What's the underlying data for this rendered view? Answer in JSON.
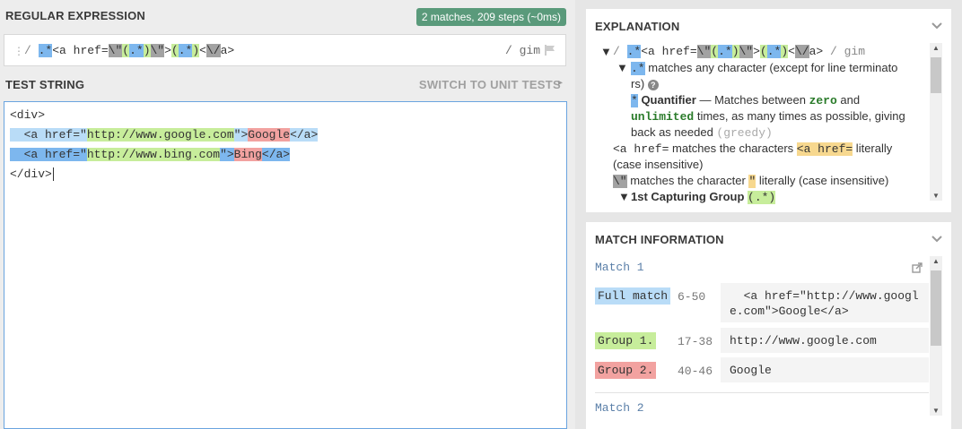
{
  "regex_section": {
    "title": "REGULAR EXPRESSION",
    "badge": "2 matches, 209 steps (~0ms)",
    "delimiter_open": "/",
    "pattern_parts": [
      ".*",
      "<a href=",
      "\\\"",
      "(",
      ".*",
      ")",
      "\\\"",
      ">",
      "(",
      ".*",
      ")",
      "<",
      "\\/",
      "a>"
    ],
    "flags": "/ gim"
  },
  "test_section": {
    "title": "TEST STRING",
    "switch_label": "SWITCH TO UNIT TESTS",
    "lines": {
      "l1": "<div>",
      "l2_pre": "  <a href=\"",
      "l2_g1": "http://www.google.com",
      "l2_mid": "\">",
      "l2_g2": "Google",
      "l2_post": "</a>",
      "l3_pre": "  <a href=\"",
      "l3_g1": "http://www.bing.com",
      "l3_mid": "\">",
      "l3_g2": "Bing",
      "l3_post": "</a>",
      "l4": "</div>"
    }
  },
  "explanation": {
    "title": "EXPLANATION",
    "root_delim": "/",
    "root_parts": [
      ".*",
      "<a href=",
      "\\\"",
      "(",
      ".*",
      ")",
      "\\\"",
      ">",
      "(",
      ".*",
      ")",
      "<",
      "\\/",
      "a>"
    ],
    "root_flags": "/ gim",
    "any_token": ".*",
    "any_text_1": "matches any character (except for line terminato",
    "any_text_2": "rs)",
    "quant_token": "*",
    "quant_label": "Quantifier",
    "quant_text_1a": " — Matches between ",
    "quant_zero": "zero",
    "quant_text_1b": " and",
    "quant_unlimited": "unlimited",
    "quant_text_2": " times, as many times as possible, giving",
    "quant_text_3a": "back as needed ",
    "quant_greedy": "(greedy)",
    "lit_token": "<a href=",
    "lit_text_a": " matches the characters ",
    "lit_text_b": " literally",
    "lit_text_2": "(case insensitive)",
    "quote_token": "\\\"",
    "quote_text_a": " matches the character ",
    "quote_char": "\"",
    "quote_text_b": " literally (case insensitive)",
    "group1_label": "1st Capturing Group",
    "group1_token": "(.*)"
  },
  "match_info": {
    "title": "MATCH INFORMATION",
    "match1_label": "Match 1",
    "rows": [
      {
        "label": "Full match",
        "range": "6-50",
        "value": "  <a href=\"http://www.googl\ne.com\">Google</a>"
      },
      {
        "label": "Group 1.",
        "range": "17-38",
        "value": "http://www.google.com"
      },
      {
        "label": "Group 2.",
        "range": "40-46",
        "value": "Google"
      }
    ],
    "match2_label": "Match 2"
  },
  "colors": {
    "accent_blue": "#7db7ee",
    "group1": "#c7ed9b",
    "group2": "#f2a2a0",
    "badge": "#5a9a7b"
  }
}
